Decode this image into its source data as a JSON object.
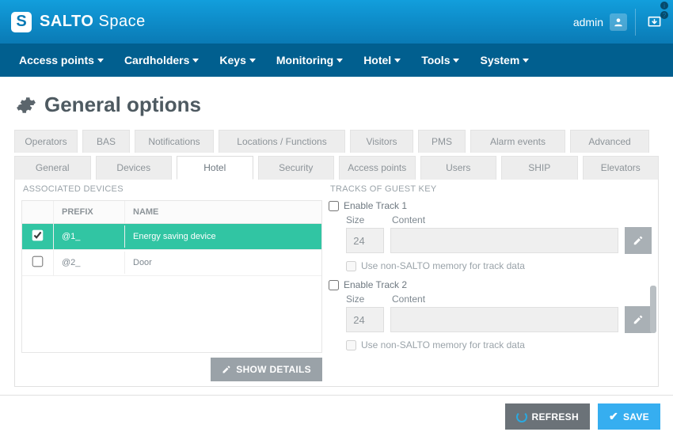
{
  "brand": {
    "logo_letter": "S",
    "name_bold": "SALTO",
    "name_light": "Space"
  },
  "user": {
    "name": "admin"
  },
  "nav": [
    "Access points",
    "Cardholders",
    "Keys",
    "Monitoring",
    "Hotel",
    "Tools",
    "System"
  ],
  "page": {
    "title": "General options"
  },
  "tabs_row1": [
    "Operators",
    "BAS",
    "Notifications",
    "Locations / Functions",
    "Visitors",
    "PMS",
    "Alarm events",
    "Advanced"
  ],
  "tabs_row2": [
    "General",
    "Devices",
    "Hotel",
    "Security",
    "Access points",
    "Users",
    "SHIP",
    "Elevators"
  ],
  "tabs_row2_active_index": 2,
  "associated": {
    "label": "ASSOCIATED DEVICES",
    "columns": {
      "prefix": "PREFIX",
      "name": "NAME"
    },
    "rows": [
      {
        "checked": true,
        "prefix": "@1_",
        "name": "Energy saving device"
      },
      {
        "checked": false,
        "prefix": "@2_",
        "name": "Door"
      }
    ]
  },
  "buttons": {
    "show_details": "SHOW DETAILS",
    "refresh": "REFRESH",
    "save": "SAVE"
  },
  "tracks": {
    "section_label": "TRACKS OF GUEST KEY",
    "size_label": "Size",
    "content_label": "Content",
    "nonsalto_label": "Use non-SALTO memory for track data",
    "items": [
      {
        "enable_label": "Enable Track 1",
        "enabled": false,
        "size": "24",
        "content": ""
      },
      {
        "enable_label": "Enable Track 2",
        "enabled": false,
        "size": "24",
        "content": ""
      }
    ]
  }
}
